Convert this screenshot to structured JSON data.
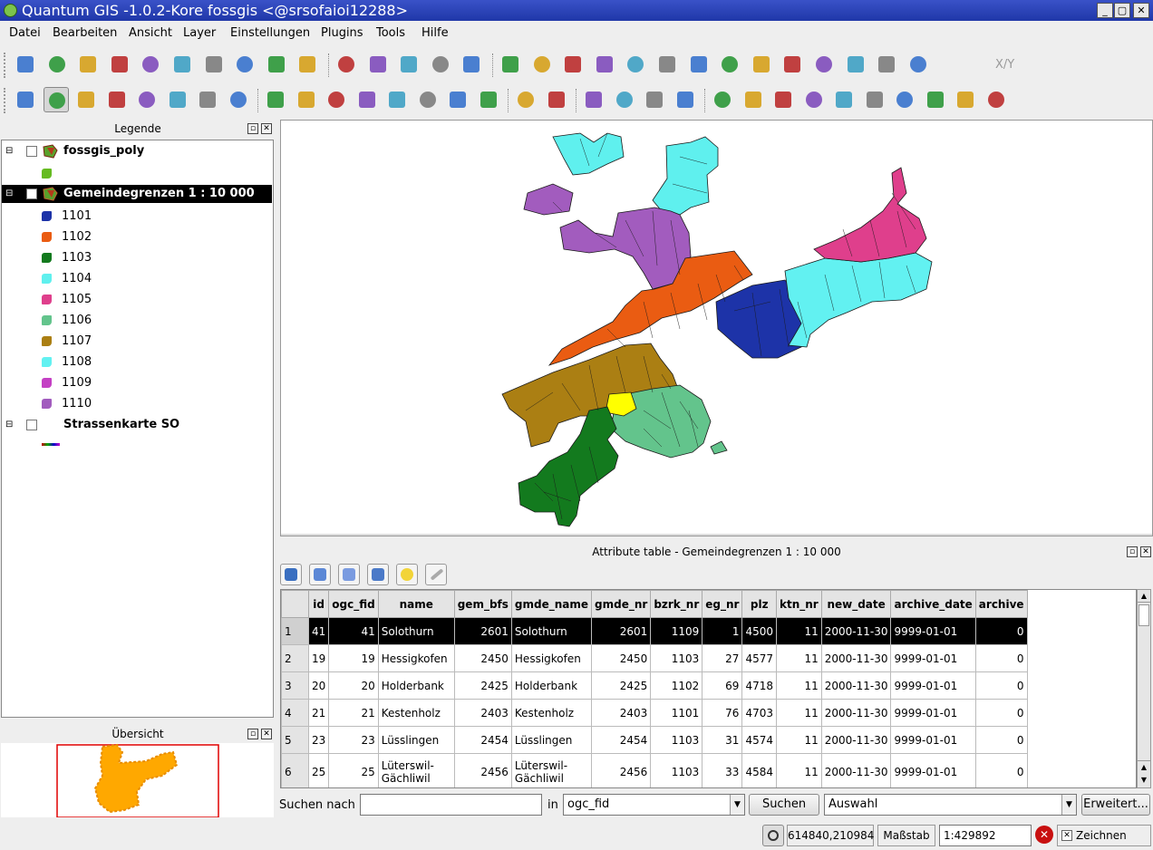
{
  "window": {
    "title": "Quantum GIS -1.0.2-Kore  fossgis <@srsofaioi12288>",
    "btn_min": "_",
    "btn_max": "▢",
    "btn_close": "✕"
  },
  "menu": [
    "Datei",
    "Bearbeiten",
    "Ansicht",
    "Layer",
    "Einstellungen",
    "Plugins",
    "Tools",
    "Hilfe"
  ],
  "toolbar1_icons": [
    "new-project-icon",
    "open-project-icon",
    "save-project-icon",
    "save-as-icon",
    "print-icon",
    "add-vector-layer-icon",
    "add-raster-layer-icon",
    "add-postgis-layer-icon",
    "add-wms-layer-icon",
    "add-wfs-layer-icon",
    "new-vector-layer-icon",
    "remove-layer-icon",
    "show-all-layers-icon",
    "eye-icon",
    "hide-all-icon",
    "toggle-edit-icon",
    "capture-point-icon",
    "capture-line-icon",
    "capture-polygon-icon",
    "add-ring-icon",
    "add-island-icon",
    "move-feature-icon",
    "split-icon",
    "move-vertex-icon",
    "delete-vertex-icon",
    "delete-selected-icon",
    "cut-icon",
    "copy-icon",
    "paste-icon"
  ],
  "toolbar1_xy": "X/Y",
  "toolbar2_icons": [
    "identify-icon",
    "select-icon",
    "open-table-icon",
    "measure-line-icon",
    "measure-area-icon",
    "map-tips-icon",
    "new-bookmark-icon",
    "show-bookmarks-icon",
    "pan-icon",
    "zoom-in-icon",
    "zoom-out-icon",
    "zoom-full-icon",
    "zoom-selection-icon",
    "zoom-layer-icon",
    "zoom-last-icon",
    "refresh-icon",
    "help-icon",
    "whats-this-icon",
    "gps-icon",
    "georeferencer-icon",
    "query-icon",
    "sql-icon",
    "add-layer-icon",
    "new-point-icon",
    "remove-icon",
    "add-feature-icon",
    "edit-icon",
    "delete-icon",
    "line-icon",
    "tool-icon",
    "quick-print-icon",
    "export-icon"
  ],
  "legend": {
    "title": "Legende",
    "layers": [
      {
        "name": "fossgis_poly",
        "color": "#66bb22"
      },
      {
        "name": "Gemeindegrenzen 1 : 10 000"
      },
      {
        "name": "Strassenkarte SO"
      }
    ],
    "classes": [
      {
        "label": "1101",
        "color": "#1d33a8"
      },
      {
        "label": "1102",
        "color": "#ea5c12"
      },
      {
        "label": "1103",
        "color": "#137a1e"
      },
      {
        "label": "1104",
        "color": "#5ff0ee"
      },
      {
        "label": "1105",
        "color": "#df3f8c"
      },
      {
        "label": "1106",
        "color": "#63c48c"
      },
      {
        "label": "1107",
        "color": "#ab7f13"
      },
      {
        "label": "1108",
        "color": "#62f1f1"
      },
      {
        "label": "1109",
        "color": "#c440c4"
      },
      {
        "label": "1110",
        "color": "#a25cbe"
      }
    ]
  },
  "overview": {
    "title": "Übersicht"
  },
  "attribute_table": {
    "title": "Attribute table - Gemeindegrenzen 1 : 10 000",
    "columns": [
      "id",
      "ogc_fid",
      "name",
      "gem_bfs",
      "gmde_name",
      "gmde_nr",
      "bzrk_nr",
      "eg_nr",
      "plz",
      "ktn_nr",
      "new_date",
      "archive_date",
      "archive"
    ],
    "rows": [
      [
        "1",
        "41",
        "41",
        "Solothurn",
        "2601",
        "Solothurn",
        "2601",
        "1109",
        "1",
        "4500",
        "11",
        "2000-11-30",
        "9999-01-01",
        "0"
      ],
      [
        "2",
        "19",
        "19",
        "Hessigkofen",
        "2450",
        "Hessigkofen",
        "2450",
        "1103",
        "27",
        "4577",
        "11",
        "2000-11-30",
        "9999-01-01",
        "0"
      ],
      [
        "3",
        "20",
        "20",
        "Holderbank",
        "2425",
        "Holderbank",
        "2425",
        "1102",
        "69",
        "4718",
        "11",
        "2000-11-30",
        "9999-01-01",
        "0"
      ],
      [
        "4",
        "21",
        "21",
        "Kestenholz",
        "2403",
        "Kestenholz",
        "2403",
        "1101",
        "76",
        "4703",
        "11",
        "2000-11-30",
        "9999-01-01",
        "0"
      ],
      [
        "5",
        "23",
        "23",
        "Lüsslingen",
        "2454",
        "Lüsslingen",
        "2454",
        "1103",
        "31",
        "4574",
        "11",
        "2000-11-30",
        "9999-01-01",
        "0"
      ],
      [
        "6",
        "25",
        "25",
        "Lüterswil-Gächliwil",
        "2456",
        "Lüterswil-Gächliwil",
        "2456",
        "1103",
        "33",
        "4584",
        "11",
        "2000-11-30",
        "9999-01-01",
        "0"
      ]
    ],
    "selected_row": 0
  },
  "search": {
    "label": "Suchen nach",
    "value": "",
    "in_label": "in",
    "field": "ogc_fid",
    "button": "Suchen",
    "mode": "Auswahl",
    "advanced": "Erweitert..."
  },
  "statusbar": {
    "coords": "614840,210984",
    "scale_label": "Maßstab",
    "scale": "1:429892",
    "render_label": "Zeichnen"
  }
}
